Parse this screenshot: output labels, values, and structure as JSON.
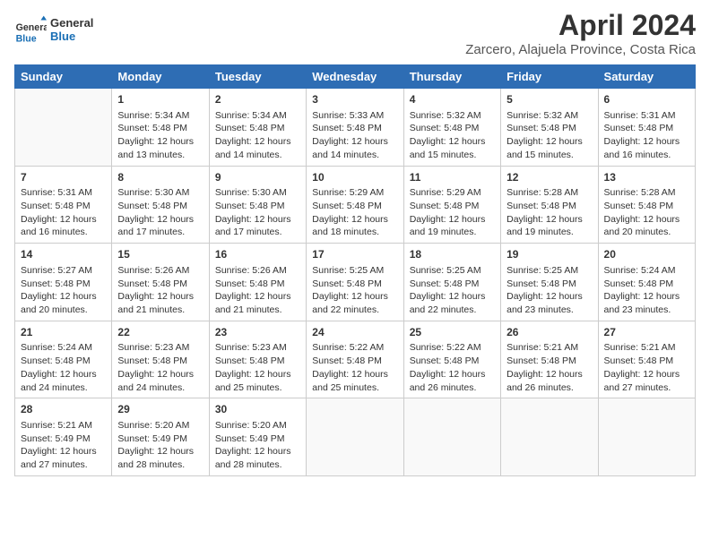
{
  "header": {
    "logo_line1": "General",
    "logo_line2": "Blue",
    "month_title": "April 2024",
    "subtitle": "Zarcero, Alajuela Province, Costa Rica"
  },
  "weekdays": [
    "Sunday",
    "Monday",
    "Tuesday",
    "Wednesday",
    "Thursday",
    "Friday",
    "Saturday"
  ],
  "weeks": [
    [
      {
        "day": "",
        "info": ""
      },
      {
        "day": "1",
        "info": "Sunrise: 5:34 AM\nSunset: 5:48 PM\nDaylight: 12 hours\nand 13 minutes."
      },
      {
        "day": "2",
        "info": "Sunrise: 5:34 AM\nSunset: 5:48 PM\nDaylight: 12 hours\nand 14 minutes."
      },
      {
        "day": "3",
        "info": "Sunrise: 5:33 AM\nSunset: 5:48 PM\nDaylight: 12 hours\nand 14 minutes."
      },
      {
        "day": "4",
        "info": "Sunrise: 5:32 AM\nSunset: 5:48 PM\nDaylight: 12 hours\nand 15 minutes."
      },
      {
        "day": "5",
        "info": "Sunrise: 5:32 AM\nSunset: 5:48 PM\nDaylight: 12 hours\nand 15 minutes."
      },
      {
        "day": "6",
        "info": "Sunrise: 5:31 AM\nSunset: 5:48 PM\nDaylight: 12 hours\nand 16 minutes."
      }
    ],
    [
      {
        "day": "7",
        "info": "Sunrise: 5:31 AM\nSunset: 5:48 PM\nDaylight: 12 hours\nand 16 minutes."
      },
      {
        "day": "8",
        "info": "Sunrise: 5:30 AM\nSunset: 5:48 PM\nDaylight: 12 hours\nand 17 minutes."
      },
      {
        "day": "9",
        "info": "Sunrise: 5:30 AM\nSunset: 5:48 PM\nDaylight: 12 hours\nand 17 minutes."
      },
      {
        "day": "10",
        "info": "Sunrise: 5:29 AM\nSunset: 5:48 PM\nDaylight: 12 hours\nand 18 minutes."
      },
      {
        "day": "11",
        "info": "Sunrise: 5:29 AM\nSunset: 5:48 PM\nDaylight: 12 hours\nand 19 minutes."
      },
      {
        "day": "12",
        "info": "Sunrise: 5:28 AM\nSunset: 5:48 PM\nDaylight: 12 hours\nand 19 minutes."
      },
      {
        "day": "13",
        "info": "Sunrise: 5:28 AM\nSunset: 5:48 PM\nDaylight: 12 hours\nand 20 minutes."
      }
    ],
    [
      {
        "day": "14",
        "info": "Sunrise: 5:27 AM\nSunset: 5:48 PM\nDaylight: 12 hours\nand 20 minutes."
      },
      {
        "day": "15",
        "info": "Sunrise: 5:26 AM\nSunset: 5:48 PM\nDaylight: 12 hours\nand 21 minutes."
      },
      {
        "day": "16",
        "info": "Sunrise: 5:26 AM\nSunset: 5:48 PM\nDaylight: 12 hours\nand 21 minutes."
      },
      {
        "day": "17",
        "info": "Sunrise: 5:25 AM\nSunset: 5:48 PM\nDaylight: 12 hours\nand 22 minutes."
      },
      {
        "day": "18",
        "info": "Sunrise: 5:25 AM\nSunset: 5:48 PM\nDaylight: 12 hours\nand 22 minutes."
      },
      {
        "day": "19",
        "info": "Sunrise: 5:25 AM\nSunset: 5:48 PM\nDaylight: 12 hours\nand 23 minutes."
      },
      {
        "day": "20",
        "info": "Sunrise: 5:24 AM\nSunset: 5:48 PM\nDaylight: 12 hours\nand 23 minutes."
      }
    ],
    [
      {
        "day": "21",
        "info": "Sunrise: 5:24 AM\nSunset: 5:48 PM\nDaylight: 12 hours\nand 24 minutes."
      },
      {
        "day": "22",
        "info": "Sunrise: 5:23 AM\nSunset: 5:48 PM\nDaylight: 12 hours\nand 24 minutes."
      },
      {
        "day": "23",
        "info": "Sunrise: 5:23 AM\nSunset: 5:48 PM\nDaylight: 12 hours\nand 25 minutes."
      },
      {
        "day": "24",
        "info": "Sunrise: 5:22 AM\nSunset: 5:48 PM\nDaylight: 12 hours\nand 25 minutes."
      },
      {
        "day": "25",
        "info": "Sunrise: 5:22 AM\nSunset: 5:48 PM\nDaylight: 12 hours\nand 26 minutes."
      },
      {
        "day": "26",
        "info": "Sunrise: 5:21 AM\nSunset: 5:48 PM\nDaylight: 12 hours\nand 26 minutes."
      },
      {
        "day": "27",
        "info": "Sunrise: 5:21 AM\nSunset: 5:48 PM\nDaylight: 12 hours\nand 27 minutes."
      }
    ],
    [
      {
        "day": "28",
        "info": "Sunrise: 5:21 AM\nSunset: 5:49 PM\nDaylight: 12 hours\nand 27 minutes."
      },
      {
        "day": "29",
        "info": "Sunrise: 5:20 AM\nSunset: 5:49 PM\nDaylight: 12 hours\nand 28 minutes."
      },
      {
        "day": "30",
        "info": "Sunrise: 5:20 AM\nSunset: 5:49 PM\nDaylight: 12 hours\nand 28 minutes."
      },
      {
        "day": "",
        "info": ""
      },
      {
        "day": "",
        "info": ""
      },
      {
        "day": "",
        "info": ""
      },
      {
        "day": "",
        "info": ""
      }
    ]
  ]
}
